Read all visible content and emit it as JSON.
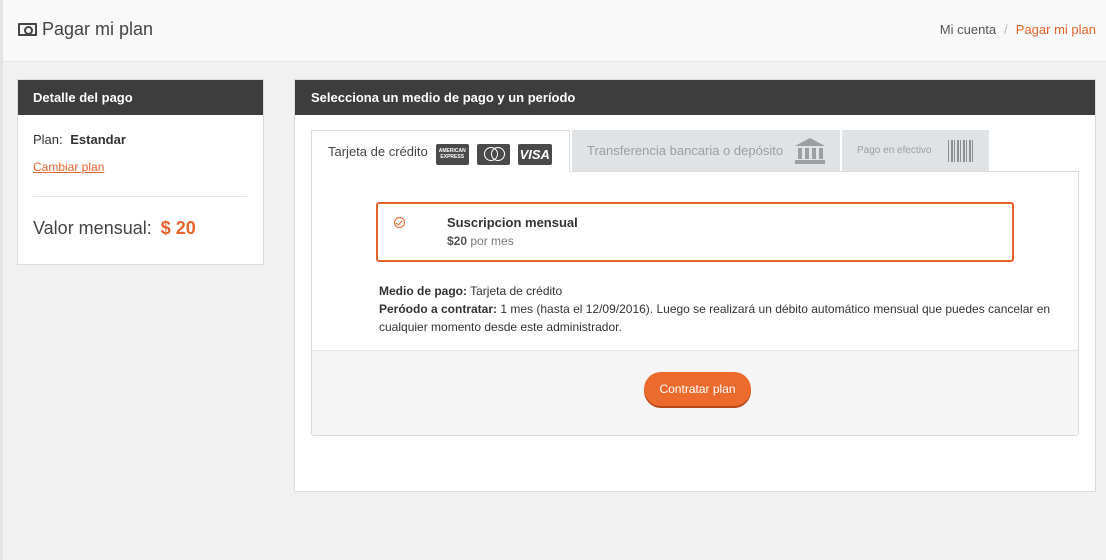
{
  "header": {
    "title": "Pagar mi plan",
    "breadcrumb": {
      "parent": "Mi cuenta",
      "separator": "/",
      "current": "Pagar mi plan"
    }
  },
  "payment_detail": {
    "heading": "Detalle del pago",
    "plan_label": "Plan:",
    "plan_name": "Estandar",
    "change_plan": "Cambiar plan",
    "monthly_label": "Valor mensual:",
    "monthly_value": "$ 20"
  },
  "payment_method": {
    "heading": "Selecciona un medio de pago y un período",
    "tabs": {
      "credit": "Tarjeta de crédito",
      "transfer": "Transferencia bancaria o depósito",
      "cash": "Pago en efectivo"
    },
    "card_logos": {
      "amex": "AMERICAN EXPRESS",
      "mastercard": "MasterCard",
      "visa": "VISA"
    },
    "subscription": {
      "title": "Suscripcion mensual",
      "price": "$20",
      "period": "por mes"
    },
    "details": {
      "method_label": "Medio de pago:",
      "method_value": "Tarjeta de crédito",
      "period_label": "Peróodo a contratar:",
      "period_value": "1 mes (hasta el 12/09/2016). Luego se realizará un débito automático mensual que puedes cancelar en cualquier momento desde este administrador."
    },
    "submit": "Contratar plan"
  },
  "colors": {
    "accent": "#e8622c",
    "dark_header": "#3d3d3d",
    "button": "#ec6a2c"
  },
  "icons": [
    "money-icon",
    "check-circle-icon",
    "bank-icon",
    "barcode-icon"
  ]
}
